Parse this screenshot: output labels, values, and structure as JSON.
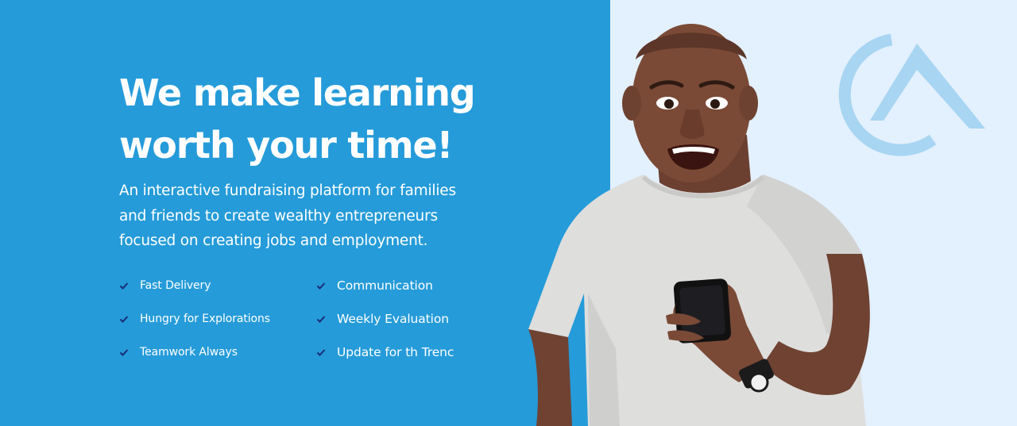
{
  "hero": {
    "headline_line1": "We make learning",
    "headline_line2": "worth your time!",
    "description_line1": "An interactive fundraising platform for families",
    "description_line2": "and friends to create wealthy entrepreneurs",
    "description_line3": "focused on creating jobs and employment.",
    "features": [
      {
        "label": "Fast Delivery",
        "icon": "check-icon"
      },
      {
        "label": "Communication",
        "icon": "check-icon"
      },
      {
        "label": "Hungry for Explorations",
        "icon": "check-icon"
      },
      {
        "label": "Weekly Evaluation",
        "icon": "check-icon"
      },
      {
        "label": "Teamwork Always",
        "icon": "check-icon"
      },
      {
        "label": "Update for th Trenc",
        "icon": "check-icon"
      }
    ]
  },
  "colors": {
    "primary_blue": "#259bd9",
    "light_background": "#e3f0fd",
    "logo_blue": "#a7d5f2",
    "check_navy": "#1b2c76",
    "white": "#ffffff"
  },
  "images": {
    "logo": "brand-logo",
    "person": "excited-man-with-phone-photo"
  }
}
